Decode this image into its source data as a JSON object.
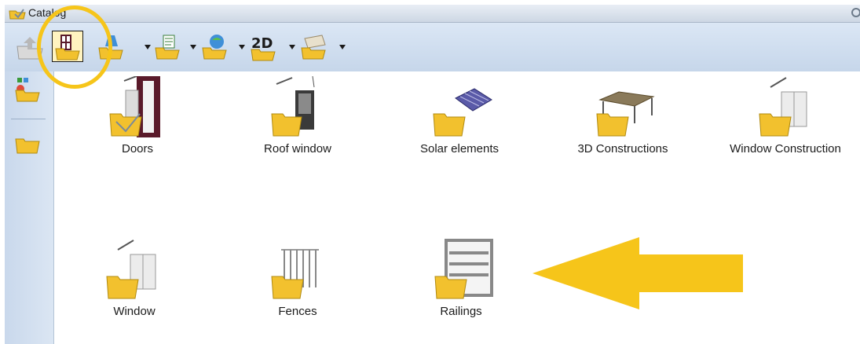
{
  "window": {
    "title": "Catalog"
  },
  "toolbar": {
    "twod_label": "2D"
  },
  "catalog": {
    "items": [
      {
        "label": "Doors"
      },
      {
        "label": "Roof window"
      },
      {
        "label": "Solar elements"
      },
      {
        "label": "3D Constructions"
      },
      {
        "label": "Window Construction"
      },
      {
        "label": "Window"
      },
      {
        "label": "Fences"
      },
      {
        "label": "Railings"
      }
    ]
  },
  "colors": {
    "annotation": "#f6c51a",
    "folder": "#f2c12e",
    "toolbar_bg": "#d2e0f0"
  }
}
